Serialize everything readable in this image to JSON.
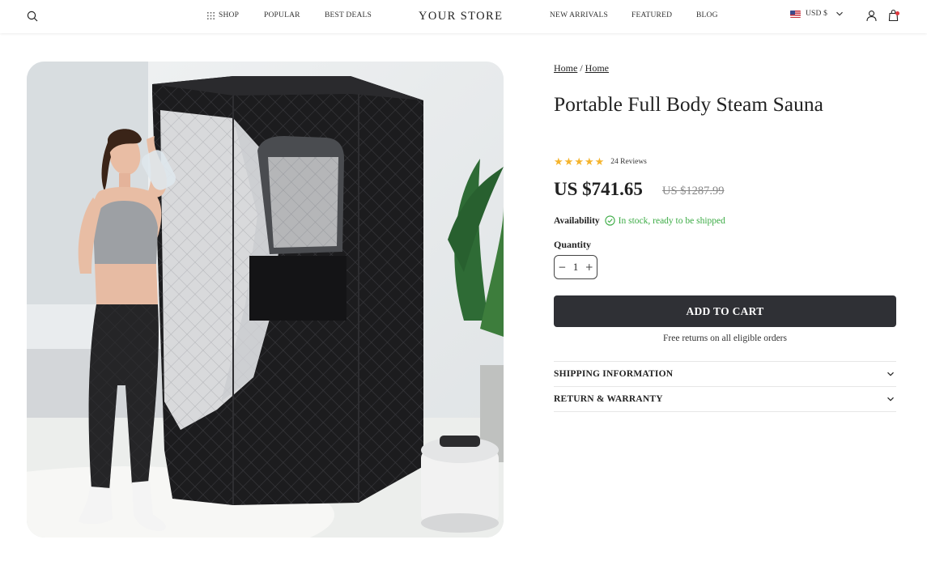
{
  "header": {
    "brand": "YOUR STORE",
    "nav_left": [
      {
        "label": "SHOP"
      },
      {
        "label": "POPULAR"
      },
      {
        "label": "BEST DEALS"
      }
    ],
    "nav_right": [
      {
        "label": "NEW ARRIVALS"
      },
      {
        "label": "FEATURED"
      },
      {
        "label": "BLOG"
      }
    ],
    "currency": "USD $",
    "icons": {
      "search": "search-icon",
      "grid": "grid-icon",
      "user": "user-icon",
      "cart": "shopping-bag-icon",
      "flag": "us-flag-icon"
    }
  },
  "breadcrumb": {
    "items": [
      {
        "label": "Home"
      },
      {
        "label": "Home"
      }
    ],
    "separator": "/"
  },
  "product": {
    "title": "Portable Full Body Steam Sauna",
    "rating": 5,
    "reviews_text": "24 Reviews",
    "price": "US $741.65",
    "compare_price": "US $1287.99",
    "availability_label": "Availability",
    "availability_status": "In stock, ready to be shipped",
    "quantity_label": "Quantity",
    "quantity": "1",
    "add_to_cart": "ADD TO CART",
    "free_returns": "Free returns on all eligible orders"
  },
  "accordion": [
    {
      "title": "SHIPPING INFORMATION"
    },
    {
      "title": "RETURN & WARRANTY"
    }
  ],
  "colors": {
    "button_bg": "#2f3035",
    "star": "#f5b42d",
    "in_stock": "#3bab44",
    "cart_badge": "#e0383e"
  }
}
